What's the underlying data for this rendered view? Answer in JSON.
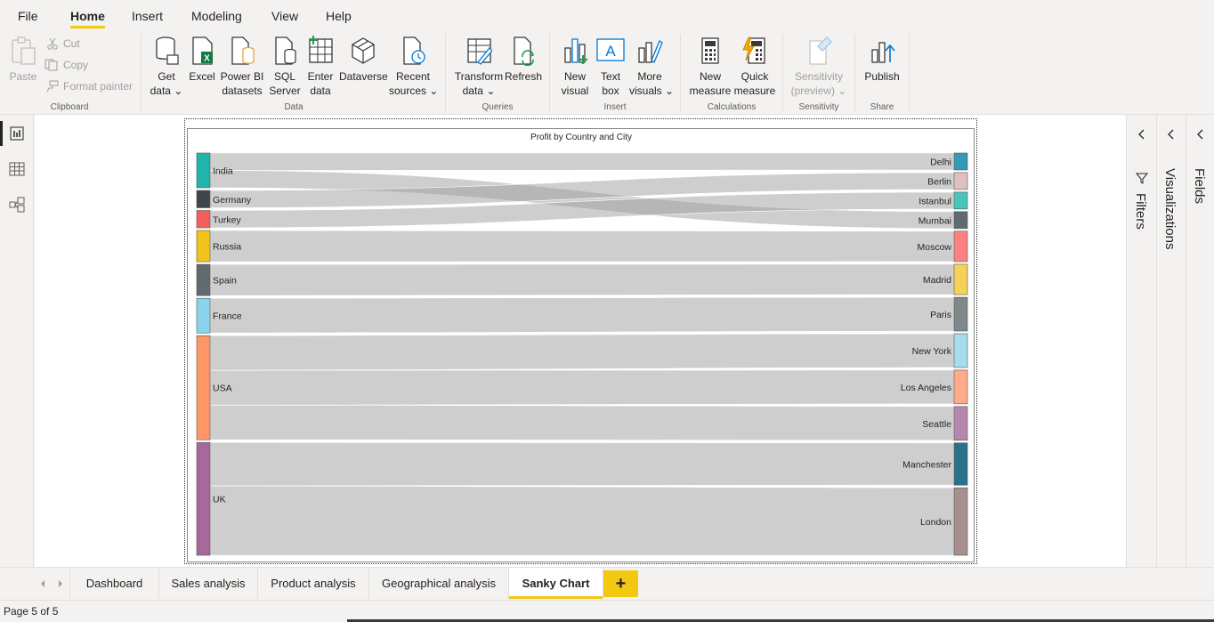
{
  "menu": {
    "tabs": [
      "File",
      "Home",
      "Insert",
      "Modeling",
      "View",
      "Help"
    ],
    "active": "Home"
  },
  "ribbon": {
    "clipboard": {
      "paste": "Paste",
      "cut": "Cut",
      "copy": "Copy",
      "format_painter": "Format painter",
      "group": "Clipboard"
    },
    "data": {
      "get_data": [
        "Get",
        "data ⌄"
      ],
      "excel": [
        "Excel"
      ],
      "powerbi": [
        "Power BI",
        "datasets"
      ],
      "sql": [
        "SQL",
        "Server"
      ],
      "enter": [
        "Enter",
        "data"
      ],
      "dataverse": [
        "Dataverse"
      ],
      "recent": [
        "Recent",
        "sources ⌄"
      ],
      "group": "Data"
    },
    "queries": {
      "transform": [
        "Transform",
        "data ⌄"
      ],
      "refresh": [
        "Refresh"
      ],
      "group": "Queries"
    },
    "insert": {
      "new_visual": [
        "New",
        "visual"
      ],
      "text_box": [
        "Text",
        "box"
      ],
      "more_visuals": [
        "More",
        "visuals ⌄"
      ],
      "group": "Insert"
    },
    "calculations": {
      "new_measure": [
        "New",
        "measure"
      ],
      "quick_measure": [
        "Quick",
        "measure"
      ],
      "group": "Calculations"
    },
    "sensitivity": {
      "label": [
        "Sensitivity",
        "(preview) ⌄"
      ],
      "group": "Sensitivity"
    },
    "share": {
      "publish": [
        "Publish"
      ],
      "group": "Share"
    }
  },
  "panes": {
    "filters": "Filters",
    "visualizations": "Visualizations",
    "fields": "Fields"
  },
  "pages": {
    "tabs": [
      "Dashboard",
      "Sales analysis",
      "Product analysis",
      "Geographical analysis",
      "Sanky Chart"
    ],
    "active": "Sanky Chart",
    "add": "+"
  },
  "status": {
    "page_count": "Page 5 of 5"
  },
  "chart_data": {
    "type": "sankey",
    "title": "Profit by Country and City",
    "sources": [
      {
        "name": "India",
        "color": "#1fb5ab"
      },
      {
        "name": "Germany",
        "color": "#3e4649"
      },
      {
        "name": "Turkey",
        "color": "#f45f5d"
      },
      {
        "name": "Russia",
        "color": "#f2c419"
      },
      {
        "name": "Spain",
        "color": "#5f6b6d"
      },
      {
        "name": "France",
        "color": "#8ad4eb"
      },
      {
        "name": "USA",
        "color": "#fe9666"
      },
      {
        "name": "UK",
        "color": "#a66999"
      }
    ],
    "targets": [
      {
        "name": "Delhi",
        "color": "#3599b8"
      },
      {
        "name": "Berlin",
        "color": "#dfbfbf"
      },
      {
        "name": "Istanbul",
        "color": "#4ac5bb"
      },
      {
        "name": "Mumbai",
        "color": "#5f6b6d"
      },
      {
        "name": "Moscow",
        "color": "#fb8281"
      },
      {
        "name": "Madrid",
        "color": "#f4d25a"
      },
      {
        "name": "Paris",
        "color": "#7f898a"
      },
      {
        "name": "New York",
        "color": "#a4ddee"
      },
      {
        "name": "Los Angeles",
        "color": "#fdab89"
      },
      {
        "name": "Seattle",
        "color": "#b687ac"
      },
      {
        "name": "Manchester",
        "color": "#28738a"
      },
      {
        "name": "London",
        "color": "#a78f8f"
      }
    ],
    "links": [
      {
        "source": "India",
        "target": "Delhi",
        "value": 20
      },
      {
        "source": "India",
        "target": "Mumbai",
        "value": 20
      },
      {
        "source": "Germany",
        "target": "Berlin",
        "value": 20
      },
      {
        "source": "Turkey",
        "target": "Istanbul",
        "value": 20
      },
      {
        "source": "Russia",
        "target": "Moscow",
        "value": 36
      },
      {
        "source": "Spain",
        "target": "Madrid",
        "value": 36
      },
      {
        "source": "France",
        "target": "Paris",
        "value": 40
      },
      {
        "source": "USA",
        "target": "New York",
        "value": 40
      },
      {
        "source": "USA",
        "target": "Los Angeles",
        "value": 40
      },
      {
        "source": "USA",
        "target": "Seattle",
        "value": 40
      },
      {
        "source": "UK",
        "target": "Manchester",
        "value": 50
      },
      {
        "source": "UK",
        "target": "London",
        "value": 80
      }
    ]
  }
}
